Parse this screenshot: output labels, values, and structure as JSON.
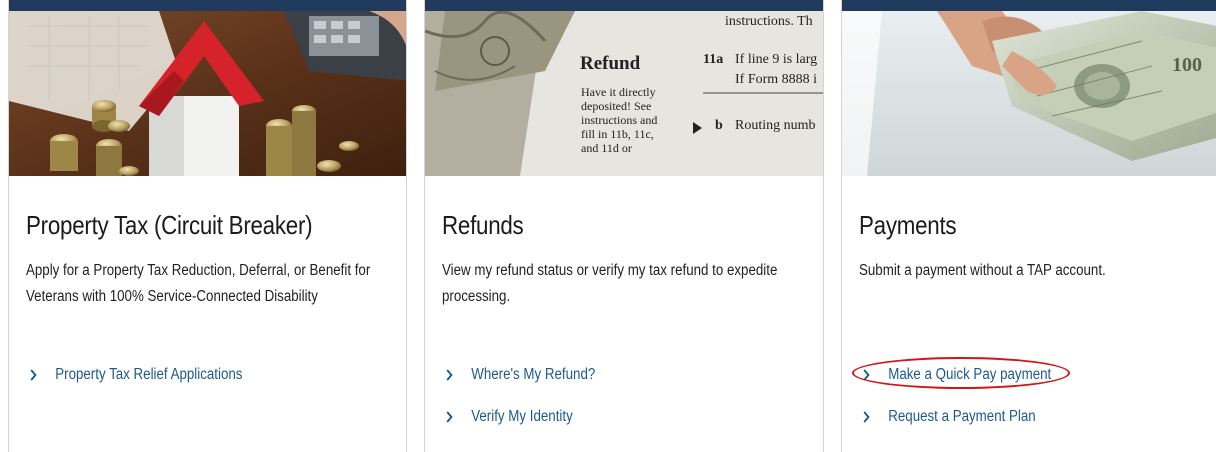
{
  "colors": {
    "topbar": "#1f3a5c",
    "link": "#1d5a8c",
    "title": "#1b1b1b",
    "annotation": "#d01616"
  },
  "cards": [
    {
      "title": "Property Tax (Circuit Breaker)",
      "description": "Apply for a Property Tax Reduction, Deferral, or Benefit for Veterans with 100% Service-Connected Disability",
      "image": "house-and-coins-photo",
      "links": [
        {
          "label": "Property Tax Relief Applications",
          "icon": "chevron-right-icon"
        }
      ]
    },
    {
      "title": "Refunds",
      "description": "View my refund status or verify my tax refund to expedite processing.",
      "image": "tax-form-refund-photo",
      "image_text": {
        "heading": "Refund",
        "side_lines": [
          "Have it directly",
          "deposited! See",
          "instructions and",
          "fill in 11b, 11c,",
          "and 11d or"
        ],
        "line_11a_num": "11a",
        "line_11a": "If line 9 is larg",
        "line_11a_2": "If Form 8888 i",
        "line_b_num": "b",
        "line_b": "Routing numb",
        "top_line": "instructions. Th"
      },
      "links": [
        {
          "label": "Where's My Refund?",
          "icon": "chevron-right-icon"
        },
        {
          "label": "Verify My Identity",
          "icon": "chevron-right-icon"
        }
      ]
    },
    {
      "title": "Payments",
      "description": "Submit a payment without a TAP account.",
      "image": "hand-holding-cash-photo",
      "links": [
        {
          "label": "Make a Quick Pay payment",
          "icon": "chevron-right-icon",
          "highlighted": true
        },
        {
          "label": "Request a Payment Plan",
          "icon": "chevron-right-icon"
        }
      ]
    }
  ]
}
